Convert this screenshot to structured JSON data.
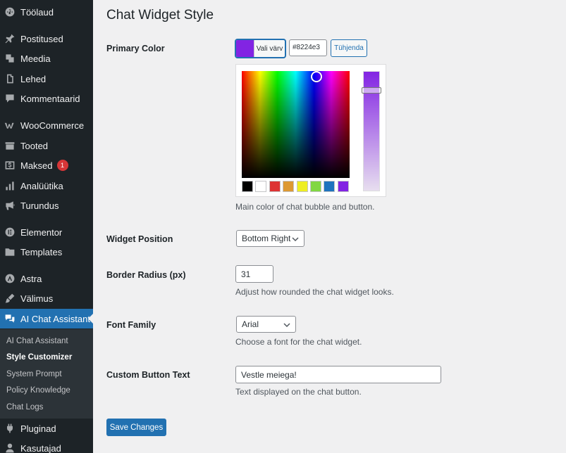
{
  "sidebar": {
    "items": [
      {
        "label": "Töölaud",
        "icon": "dashboard-icon"
      },
      {
        "label": "Postitused",
        "icon": "pin-icon"
      },
      {
        "label": "Meedia",
        "icon": "media-icon"
      },
      {
        "label": "Lehed",
        "icon": "pages-icon"
      },
      {
        "label": "Kommentaarid",
        "icon": "comments-icon"
      },
      {
        "label": "WooCommerce",
        "icon": "woocommerce-icon"
      },
      {
        "label": "Tooted",
        "icon": "products-icon"
      },
      {
        "label": "Maksed",
        "icon": "payments-icon",
        "badge": "1"
      },
      {
        "label": "Analüütika",
        "icon": "analytics-icon"
      },
      {
        "label": "Turundus",
        "icon": "megaphone-icon"
      },
      {
        "label": "Elementor",
        "icon": "elementor-icon"
      },
      {
        "label": "Templates",
        "icon": "folder-icon"
      },
      {
        "label": "Astra",
        "icon": "astra-icon"
      },
      {
        "label": "Välimus",
        "icon": "brush-icon"
      },
      {
        "label": "AI Chat Assistant",
        "icon": "chat-icon",
        "active": true
      },
      {
        "label": "Pluginad",
        "icon": "plugin-icon"
      },
      {
        "label": "Kasutajad",
        "icon": "users-icon"
      }
    ],
    "submenu": [
      {
        "label": "AI Chat Assistant"
      },
      {
        "label": "Style Customizer",
        "current": true
      },
      {
        "label": "System Prompt"
      },
      {
        "label": "Policy Knowledge"
      },
      {
        "label": "Chat Logs"
      }
    ]
  },
  "page": {
    "title": "Chat Widget Style",
    "primary_color": {
      "label": "Primary Color",
      "button_text": "Vali värv",
      "hex_value": "#8224e3",
      "clear_label": "Tühjenda",
      "description": "Main color of chat bubble and button.",
      "current_color": "#8224e3",
      "palette": [
        "#000000",
        "#ffffff",
        "#dd3333",
        "#dd9933",
        "#eeee22",
        "#81d742",
        "#1e73be",
        "#8224e3"
      ]
    },
    "widget_position": {
      "label": "Widget Position",
      "value": "Bottom Right"
    },
    "border_radius": {
      "label": "Border Radius (px)",
      "value": "31",
      "description": "Adjust how rounded the chat widget looks."
    },
    "font_family": {
      "label": "Font Family",
      "value": "Arial",
      "description": "Choose a font for the chat widget."
    },
    "custom_button_text": {
      "label": "Custom Button Text",
      "value": "Vestle meiega!",
      "description": "Text displayed on the chat button."
    },
    "save_label": "Save Changes"
  },
  "colors": {
    "accent": "#2271b1",
    "sidebar_bg": "#1d2327",
    "badge": "#d63638"
  }
}
